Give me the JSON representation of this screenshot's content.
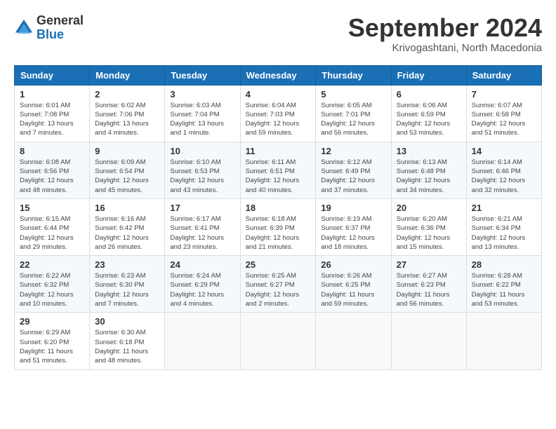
{
  "logo": {
    "general": "General",
    "blue": "Blue"
  },
  "header": {
    "month": "September 2024",
    "location": "Krivogashtani, North Macedonia"
  },
  "weekdays": [
    "Sunday",
    "Monday",
    "Tuesday",
    "Wednesday",
    "Thursday",
    "Friday",
    "Saturday"
  ],
  "weeks": [
    [
      {
        "day": "1",
        "info": "Sunrise: 6:01 AM\nSunset: 7:08 PM\nDaylight: 13 hours\nand 7 minutes."
      },
      {
        "day": "2",
        "info": "Sunrise: 6:02 AM\nSunset: 7:06 PM\nDaylight: 13 hours\nand 4 minutes."
      },
      {
        "day": "3",
        "info": "Sunrise: 6:03 AM\nSunset: 7:04 PM\nDaylight: 13 hours\nand 1 minute."
      },
      {
        "day": "4",
        "info": "Sunrise: 6:04 AM\nSunset: 7:03 PM\nDaylight: 12 hours\nand 59 minutes."
      },
      {
        "day": "5",
        "info": "Sunrise: 6:05 AM\nSunset: 7:01 PM\nDaylight: 12 hours\nand 56 minutes."
      },
      {
        "day": "6",
        "info": "Sunrise: 6:06 AM\nSunset: 6:59 PM\nDaylight: 12 hours\nand 53 minutes."
      },
      {
        "day": "7",
        "info": "Sunrise: 6:07 AM\nSunset: 6:58 PM\nDaylight: 12 hours\nand 51 minutes."
      }
    ],
    [
      {
        "day": "8",
        "info": "Sunrise: 6:08 AM\nSunset: 6:56 PM\nDaylight: 12 hours\nand 48 minutes."
      },
      {
        "day": "9",
        "info": "Sunrise: 6:09 AM\nSunset: 6:54 PM\nDaylight: 12 hours\nand 45 minutes."
      },
      {
        "day": "10",
        "info": "Sunrise: 6:10 AM\nSunset: 6:53 PM\nDaylight: 12 hours\nand 43 minutes."
      },
      {
        "day": "11",
        "info": "Sunrise: 6:11 AM\nSunset: 6:51 PM\nDaylight: 12 hours\nand 40 minutes."
      },
      {
        "day": "12",
        "info": "Sunrise: 6:12 AM\nSunset: 6:49 PM\nDaylight: 12 hours\nand 37 minutes."
      },
      {
        "day": "13",
        "info": "Sunrise: 6:13 AM\nSunset: 6:48 PM\nDaylight: 12 hours\nand 34 minutes."
      },
      {
        "day": "14",
        "info": "Sunrise: 6:14 AM\nSunset: 6:46 PM\nDaylight: 12 hours\nand 32 minutes."
      }
    ],
    [
      {
        "day": "15",
        "info": "Sunrise: 6:15 AM\nSunset: 6:44 PM\nDaylight: 12 hours\nand 29 minutes."
      },
      {
        "day": "16",
        "info": "Sunrise: 6:16 AM\nSunset: 6:42 PM\nDaylight: 12 hours\nand 26 minutes."
      },
      {
        "day": "17",
        "info": "Sunrise: 6:17 AM\nSunset: 6:41 PM\nDaylight: 12 hours\nand 23 minutes."
      },
      {
        "day": "18",
        "info": "Sunrise: 6:18 AM\nSunset: 6:39 PM\nDaylight: 12 hours\nand 21 minutes."
      },
      {
        "day": "19",
        "info": "Sunrise: 6:19 AM\nSunset: 6:37 PM\nDaylight: 12 hours\nand 18 minutes."
      },
      {
        "day": "20",
        "info": "Sunrise: 6:20 AM\nSunset: 6:36 PM\nDaylight: 12 hours\nand 15 minutes."
      },
      {
        "day": "21",
        "info": "Sunrise: 6:21 AM\nSunset: 6:34 PM\nDaylight: 12 hours\nand 13 minutes."
      }
    ],
    [
      {
        "day": "22",
        "info": "Sunrise: 6:22 AM\nSunset: 6:32 PM\nDaylight: 12 hours\nand 10 minutes."
      },
      {
        "day": "23",
        "info": "Sunrise: 6:23 AM\nSunset: 6:30 PM\nDaylight: 12 hours\nand 7 minutes."
      },
      {
        "day": "24",
        "info": "Sunrise: 6:24 AM\nSunset: 6:29 PM\nDaylight: 12 hours\nand 4 minutes."
      },
      {
        "day": "25",
        "info": "Sunrise: 6:25 AM\nSunset: 6:27 PM\nDaylight: 12 hours\nand 2 minutes."
      },
      {
        "day": "26",
        "info": "Sunrise: 6:26 AM\nSunset: 6:25 PM\nDaylight: 11 hours\nand 59 minutes."
      },
      {
        "day": "27",
        "info": "Sunrise: 6:27 AM\nSunset: 6:23 PM\nDaylight: 11 hours\nand 56 minutes."
      },
      {
        "day": "28",
        "info": "Sunrise: 6:28 AM\nSunset: 6:22 PM\nDaylight: 11 hours\nand 53 minutes."
      }
    ],
    [
      {
        "day": "29",
        "info": "Sunrise: 6:29 AM\nSunset: 6:20 PM\nDaylight: 11 hours\nand 51 minutes."
      },
      {
        "day": "30",
        "info": "Sunrise: 6:30 AM\nSunset: 6:18 PM\nDaylight: 11 hours\nand 48 minutes."
      },
      {
        "day": "",
        "info": ""
      },
      {
        "day": "",
        "info": ""
      },
      {
        "day": "",
        "info": ""
      },
      {
        "day": "",
        "info": ""
      },
      {
        "day": "",
        "info": ""
      }
    ]
  ]
}
